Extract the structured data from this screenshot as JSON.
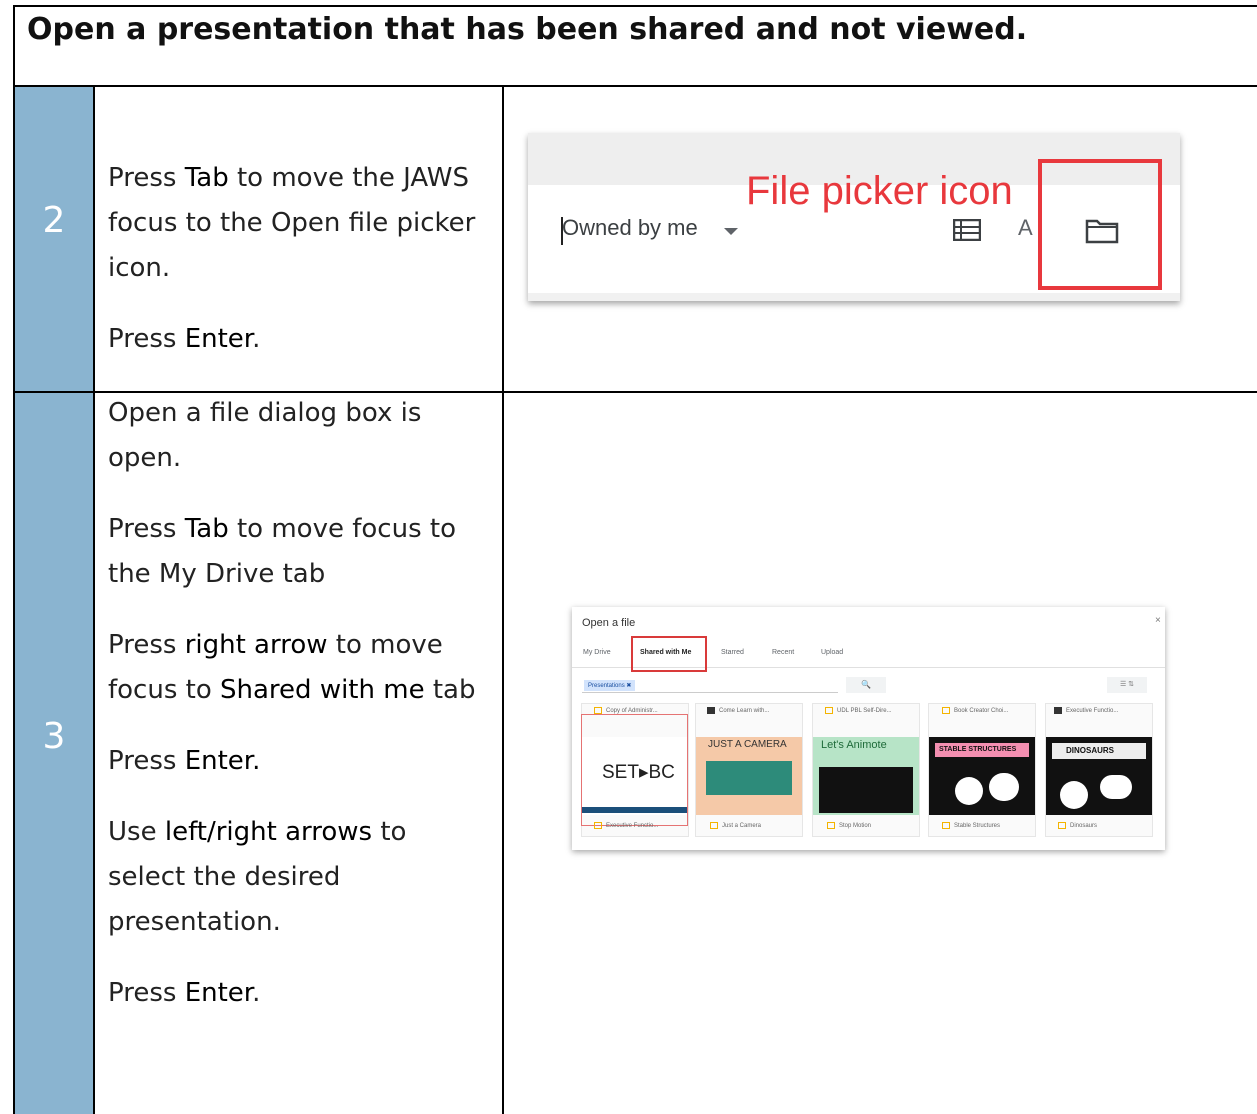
{
  "title": "Open a presentation that has been shared and not viewed.",
  "steps": [
    {
      "number": "2",
      "paragraphs": [
        {
          "parts": [
            {
              "t": "Press "
            },
            {
              "t": "Tab",
              "key": true
            },
            {
              "t": " to move the JAWS focus to the Open file picker icon."
            }
          ]
        },
        {
          "parts": [
            {
              "t": "Press "
            },
            {
              "t": "Enter",
              "key": true
            },
            {
              "t": "."
            }
          ]
        }
      ]
    },
    {
      "number": "3",
      "paragraphs": [
        {
          "parts": [
            {
              "t": "Open a file dialog box is open."
            }
          ]
        },
        {
          "parts": [
            {
              "t": "Press "
            },
            {
              "t": "Tab",
              "key": true
            },
            {
              "t": " to move focus to the My Drive tab"
            }
          ]
        },
        {
          "parts": [
            {
              "t": "Press "
            },
            {
              "t": "right arrow",
              "key": true
            },
            {
              "t": " to move focus to "
            },
            {
              "t": "Shared with me",
              "key": true
            },
            {
              "t": " tab"
            }
          ]
        },
        {
          "parts": [
            {
              "t": "Press "
            },
            {
              "t": "Enter.",
              "key": true
            }
          ]
        },
        {
          "parts": [
            {
              "t": "Use "
            },
            {
              "t": "left/right arrows",
              "key": true
            },
            {
              "t": " to select the desired presentation."
            }
          ]
        },
        {
          "parts": [
            {
              "t": "Press "
            },
            {
              "t": "Enter",
              "key": true
            },
            {
              "t": "."
            }
          ]
        }
      ]
    }
  ],
  "screenshot1": {
    "callout": "File picker icon",
    "dropdown_label": "Owned by me",
    "sort_label": "A",
    "callout_color": "#e8383d"
  },
  "screenshot2": {
    "dialog_title": "Open a file",
    "close_glyph": "×",
    "tabs": [
      "My Drive",
      "Shared with Me",
      "Starred",
      "Recent",
      "Upload"
    ],
    "active_tab": "Shared with Me",
    "filter_chip": "Presentations ✖",
    "search_glyph": "🔍",
    "top_row": [
      "Copy of Administr...",
      "Come Learn with...",
      "UDL PBL Self-Dire...",
      "Book Creator Choi...",
      "Executive Functio..."
    ],
    "bottom_row": [
      "Executive Functio...",
      "Just a Camera",
      "Stop Motion",
      "Stable Structures",
      "Dinosaurs"
    ],
    "thumb_labels": [
      "SET▸BC",
      "JUST A CAMERA",
      "Let's Animote",
      "STABLE STRUCTURES",
      "DINOSAURS"
    ]
  }
}
